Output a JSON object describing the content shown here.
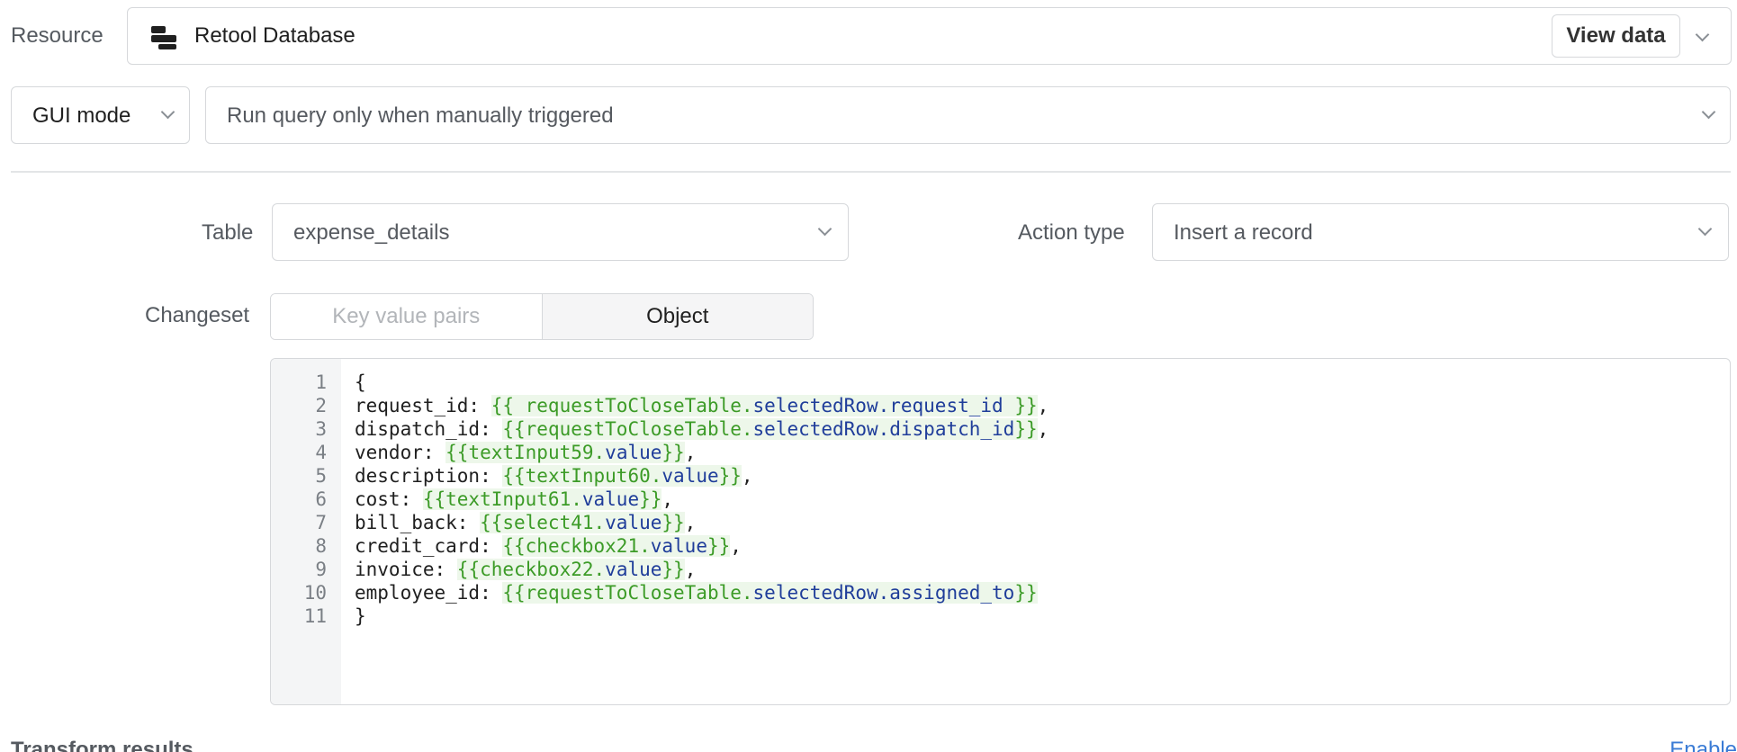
{
  "resource": {
    "label": "Resource",
    "icon": "retool-database-icon",
    "name": "Retool Database",
    "view_data_label": "View data"
  },
  "mode": {
    "selected": "GUI mode"
  },
  "trigger": {
    "selected": "Run query only when manually triggered"
  },
  "table": {
    "label": "Table",
    "selected": "expense_details"
  },
  "action": {
    "label": "Action type",
    "selected": "Insert a record"
  },
  "changeset": {
    "label": "Changeset",
    "options": [
      "Key value pairs",
      "Object"
    ],
    "active": "Object"
  },
  "editor": {
    "line_numbers": [
      "1",
      "2",
      "3",
      "4",
      "5",
      "6",
      "7",
      "8",
      "9",
      "10",
      "11"
    ],
    "lines": [
      {
        "key": "{",
        "tpl": "",
        "prop": "",
        "tail": "",
        "suffix": ""
      },
      {
        "key": "request_id: ",
        "tpl": "{{ requestToCloseTable.",
        "prop": "selectedRow.request_id",
        "tail": " }}",
        "suffix": ","
      },
      {
        "key": "dispatch_id: ",
        "tpl": "{{requestToCloseTable.",
        "prop": "selectedRow.dispatch_id",
        "tail": "}}",
        "suffix": ","
      },
      {
        "key": "vendor: ",
        "tpl": "{{textInput59.",
        "prop": "value",
        "tail": "}}",
        "suffix": ","
      },
      {
        "key": "description: ",
        "tpl": "{{textInput60.",
        "prop": "value",
        "tail": "}}",
        "suffix": ","
      },
      {
        "key": "cost: ",
        "tpl": "{{textInput61.",
        "prop": "value",
        "tail": "}}",
        "suffix": ","
      },
      {
        "key": "bill_back: ",
        "tpl": "{{select41.",
        "prop": "value",
        "tail": "}}",
        "suffix": ","
      },
      {
        "key": "credit_card: ",
        "tpl": "{{checkbox21.",
        "prop": "value",
        "tail": "}}",
        "suffix": ","
      },
      {
        "key": "invoice: ",
        "tpl": "{{checkbox22.",
        "prop": "value",
        "tail": "}}",
        "suffix": ","
      },
      {
        "key": "employee_id: ",
        "tpl": "{{requestToCloseTable.",
        "prop": "selectedRow.assigned_to",
        "tail": "}}",
        "suffix": ""
      },
      {
        "key": "}",
        "tpl": "",
        "prop": "",
        "tail": "",
        "suffix": ""
      }
    ]
  },
  "transform": {
    "label": "Transform results",
    "enable_label": "Enable"
  },
  "colors": {
    "template": "#3c9b27",
    "property": "#1f3d9a",
    "link": "#3a7bd5"
  }
}
